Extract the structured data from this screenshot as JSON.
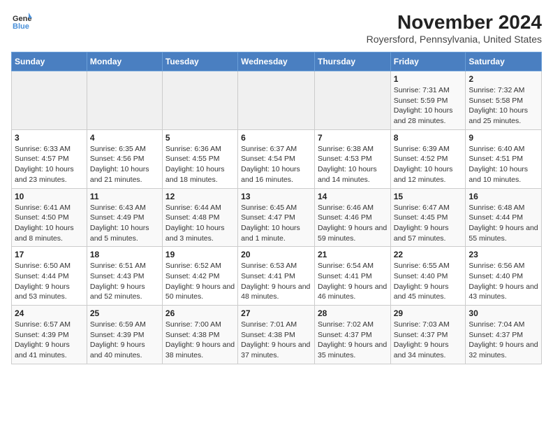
{
  "logo": {
    "line1": "General",
    "line2": "Blue"
  },
  "title": "November 2024",
  "subtitle": "Royersford, Pennsylvania, United States",
  "headers": [
    "Sunday",
    "Monday",
    "Tuesday",
    "Wednesday",
    "Thursday",
    "Friday",
    "Saturday"
  ],
  "weeks": [
    [
      {
        "day": "",
        "info": ""
      },
      {
        "day": "",
        "info": ""
      },
      {
        "day": "",
        "info": ""
      },
      {
        "day": "",
        "info": ""
      },
      {
        "day": "",
        "info": ""
      },
      {
        "day": "1",
        "info": "Sunrise: 7:31 AM\nSunset: 5:59 PM\nDaylight: 10 hours and 28 minutes."
      },
      {
        "day": "2",
        "info": "Sunrise: 7:32 AM\nSunset: 5:58 PM\nDaylight: 10 hours and 25 minutes."
      }
    ],
    [
      {
        "day": "3",
        "info": "Sunrise: 6:33 AM\nSunset: 4:57 PM\nDaylight: 10 hours and 23 minutes."
      },
      {
        "day": "4",
        "info": "Sunrise: 6:35 AM\nSunset: 4:56 PM\nDaylight: 10 hours and 21 minutes."
      },
      {
        "day": "5",
        "info": "Sunrise: 6:36 AM\nSunset: 4:55 PM\nDaylight: 10 hours and 18 minutes."
      },
      {
        "day": "6",
        "info": "Sunrise: 6:37 AM\nSunset: 4:54 PM\nDaylight: 10 hours and 16 minutes."
      },
      {
        "day": "7",
        "info": "Sunrise: 6:38 AM\nSunset: 4:53 PM\nDaylight: 10 hours and 14 minutes."
      },
      {
        "day": "8",
        "info": "Sunrise: 6:39 AM\nSunset: 4:52 PM\nDaylight: 10 hours and 12 minutes."
      },
      {
        "day": "9",
        "info": "Sunrise: 6:40 AM\nSunset: 4:51 PM\nDaylight: 10 hours and 10 minutes."
      }
    ],
    [
      {
        "day": "10",
        "info": "Sunrise: 6:41 AM\nSunset: 4:50 PM\nDaylight: 10 hours and 8 minutes."
      },
      {
        "day": "11",
        "info": "Sunrise: 6:43 AM\nSunset: 4:49 PM\nDaylight: 10 hours and 5 minutes."
      },
      {
        "day": "12",
        "info": "Sunrise: 6:44 AM\nSunset: 4:48 PM\nDaylight: 10 hours and 3 minutes."
      },
      {
        "day": "13",
        "info": "Sunrise: 6:45 AM\nSunset: 4:47 PM\nDaylight: 10 hours and 1 minute."
      },
      {
        "day": "14",
        "info": "Sunrise: 6:46 AM\nSunset: 4:46 PM\nDaylight: 9 hours and 59 minutes."
      },
      {
        "day": "15",
        "info": "Sunrise: 6:47 AM\nSunset: 4:45 PM\nDaylight: 9 hours and 57 minutes."
      },
      {
        "day": "16",
        "info": "Sunrise: 6:48 AM\nSunset: 4:44 PM\nDaylight: 9 hours and 55 minutes."
      }
    ],
    [
      {
        "day": "17",
        "info": "Sunrise: 6:50 AM\nSunset: 4:44 PM\nDaylight: 9 hours and 53 minutes."
      },
      {
        "day": "18",
        "info": "Sunrise: 6:51 AM\nSunset: 4:43 PM\nDaylight: 9 hours and 52 minutes."
      },
      {
        "day": "19",
        "info": "Sunrise: 6:52 AM\nSunset: 4:42 PM\nDaylight: 9 hours and 50 minutes."
      },
      {
        "day": "20",
        "info": "Sunrise: 6:53 AM\nSunset: 4:41 PM\nDaylight: 9 hours and 48 minutes."
      },
      {
        "day": "21",
        "info": "Sunrise: 6:54 AM\nSunset: 4:41 PM\nDaylight: 9 hours and 46 minutes."
      },
      {
        "day": "22",
        "info": "Sunrise: 6:55 AM\nSunset: 4:40 PM\nDaylight: 9 hours and 45 minutes."
      },
      {
        "day": "23",
        "info": "Sunrise: 6:56 AM\nSunset: 4:40 PM\nDaylight: 9 hours and 43 minutes."
      }
    ],
    [
      {
        "day": "24",
        "info": "Sunrise: 6:57 AM\nSunset: 4:39 PM\nDaylight: 9 hours and 41 minutes."
      },
      {
        "day": "25",
        "info": "Sunrise: 6:59 AM\nSunset: 4:39 PM\nDaylight: 9 hours and 40 minutes."
      },
      {
        "day": "26",
        "info": "Sunrise: 7:00 AM\nSunset: 4:38 PM\nDaylight: 9 hours and 38 minutes."
      },
      {
        "day": "27",
        "info": "Sunrise: 7:01 AM\nSunset: 4:38 PM\nDaylight: 9 hours and 37 minutes."
      },
      {
        "day": "28",
        "info": "Sunrise: 7:02 AM\nSunset: 4:37 PM\nDaylight: 9 hours and 35 minutes."
      },
      {
        "day": "29",
        "info": "Sunrise: 7:03 AM\nSunset: 4:37 PM\nDaylight: 9 hours and 34 minutes."
      },
      {
        "day": "30",
        "info": "Sunrise: 7:04 AM\nSunset: 4:37 PM\nDaylight: 9 hours and 32 minutes."
      }
    ]
  ]
}
